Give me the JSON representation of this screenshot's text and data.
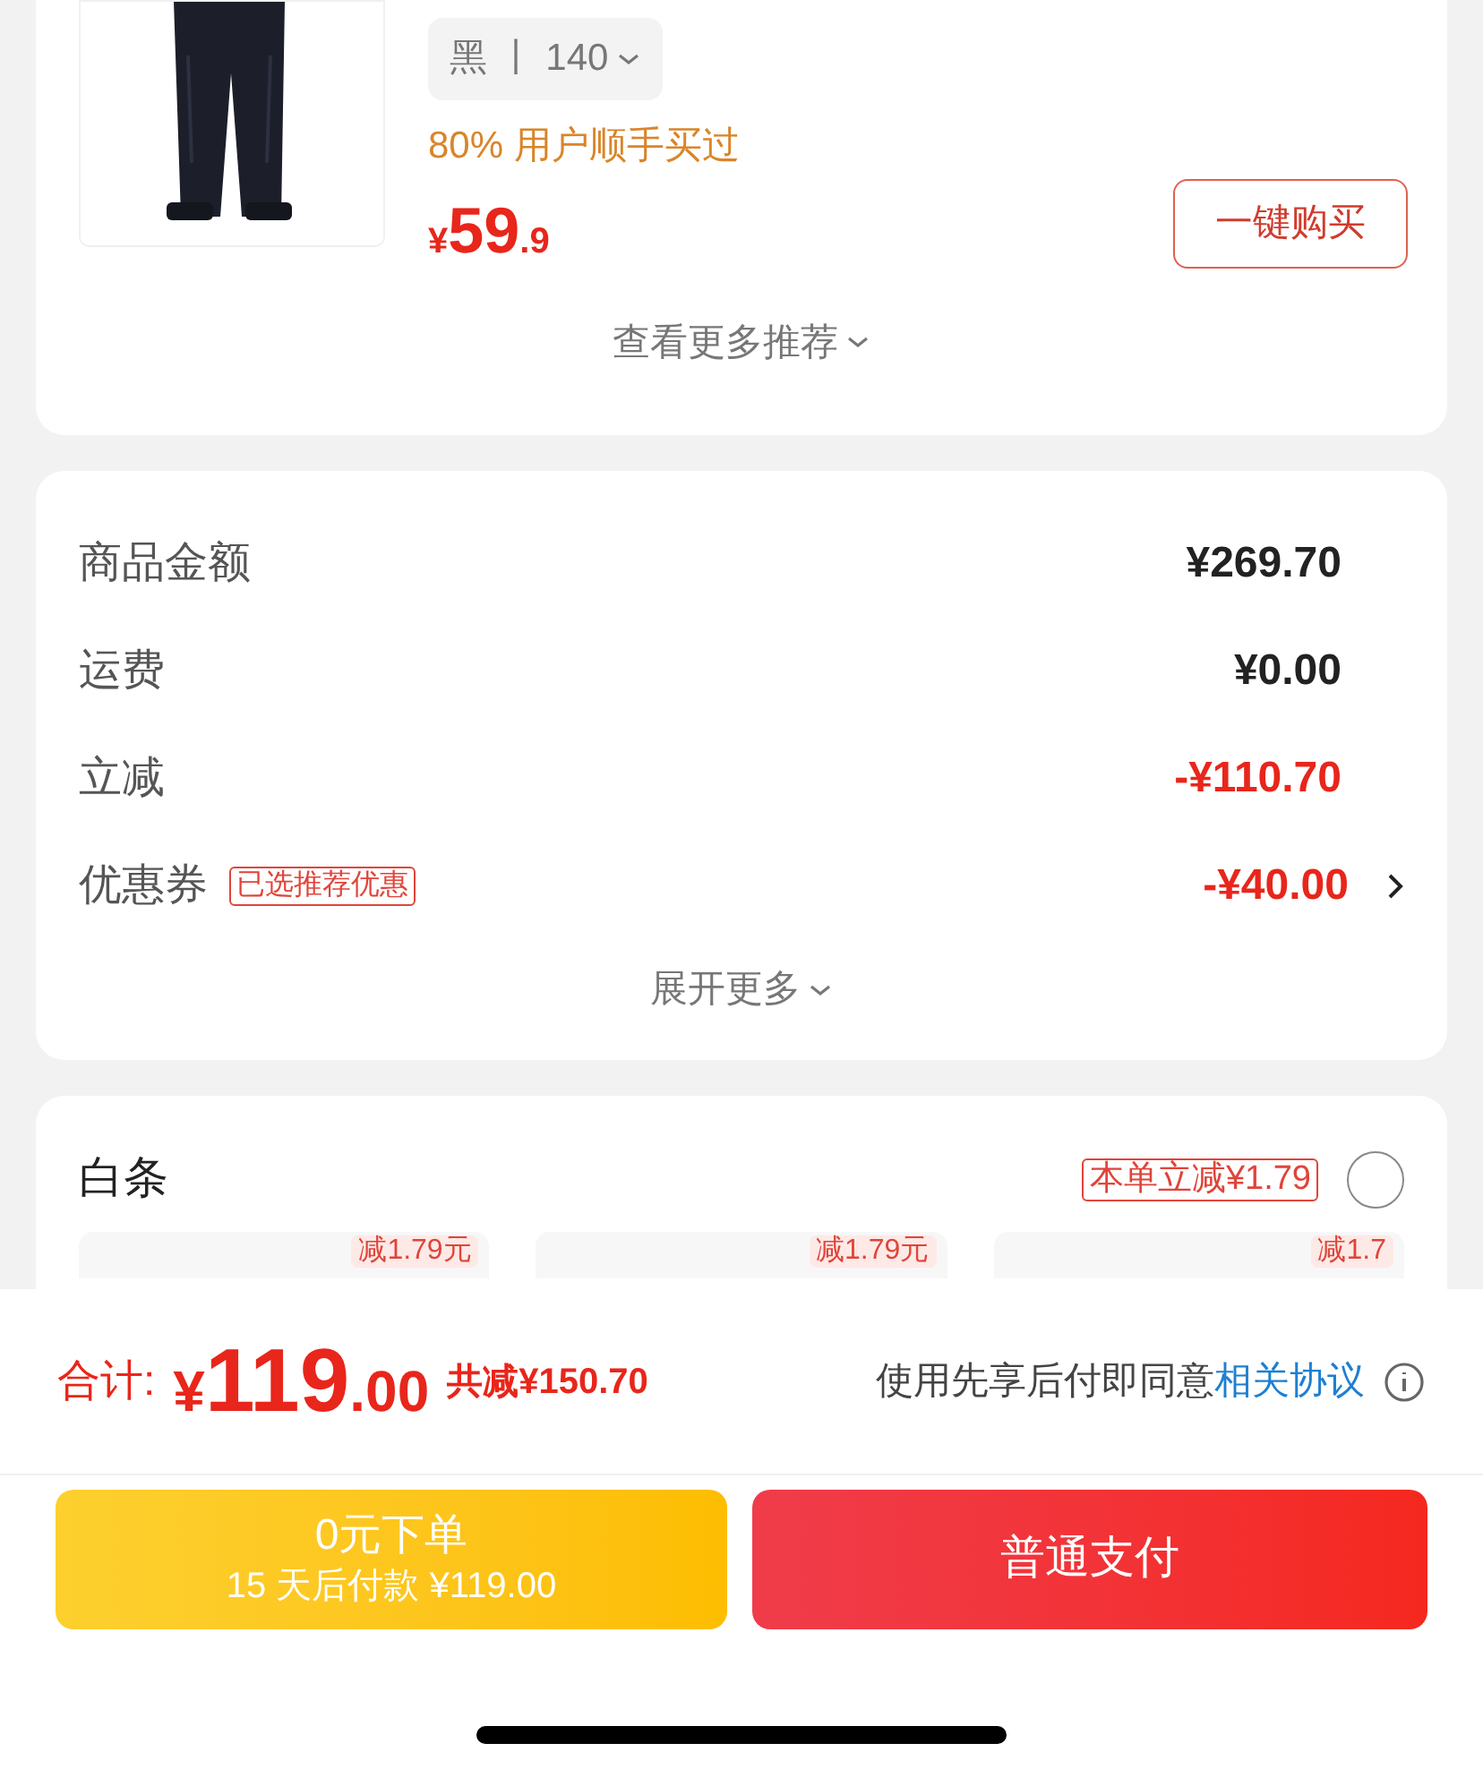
{
  "recommend": {
    "spec": "黑 丨 140",
    "social_proof": "80% 用户顺手买过",
    "price_symbol": "¥",
    "price_int": "59",
    "price_dec": ".9",
    "buy_button": "一键购买",
    "more": "查看更多推荐"
  },
  "summary": {
    "rows": [
      {
        "label": "商品金额",
        "value": "¥269.70",
        "kind": "plain"
      },
      {
        "label": "运费",
        "value": "¥0.00",
        "kind": "plain"
      },
      {
        "label": "立减",
        "value": "-¥110.70",
        "kind": "discount"
      },
      {
        "label": "优惠券",
        "tag": "已选推荐优惠",
        "value": "-¥40.00",
        "kind": "coupon"
      }
    ],
    "expand": "展开更多"
  },
  "baitiao": {
    "title": "白条",
    "promo": "本单立减¥1.79",
    "selected": false,
    "plans": [
      {
        "tag": "减1.79元"
      },
      {
        "tag": "减1.79元"
      },
      {
        "tag": "减1.7"
      }
    ]
  },
  "footer": {
    "total_label": "合计:",
    "total_symbol": "¥",
    "total_int": "119",
    "total_dec": ".00",
    "saved": "共减¥150.70",
    "agreement": "使用先享后付即同意",
    "agreement_link": "相关协议",
    "later_button": {
      "title": "0元下单",
      "subtitle": "15 天后付款 ¥119.00"
    },
    "pay_button": "普通支付"
  }
}
